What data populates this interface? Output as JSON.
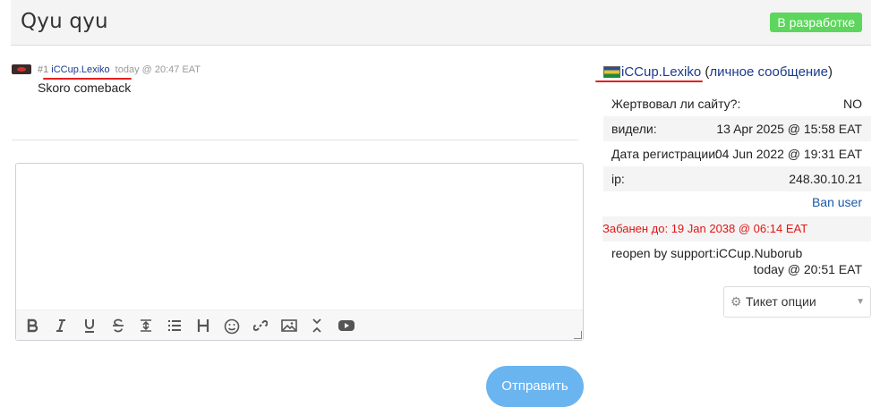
{
  "header": {
    "title": "Qyu qyu",
    "status": "В разработке",
    "status_color": "#5cd65c"
  },
  "message": {
    "number": "#1",
    "author": "iCCup.Lexiko",
    "time": "today @ 20:47 EAT",
    "text": "Skoro comeback"
  },
  "editor": {
    "toolbar": [
      "bold-icon",
      "italic-icon",
      "underline-icon",
      "strikethrough-icon",
      "horizontal-rule-icon",
      "list-icon",
      "heading-icon",
      "smiley-icon",
      "link-icon",
      "image-icon",
      "collapse-icon",
      "youtube-icon"
    ]
  },
  "send_label": "Отправить",
  "sidebar": {
    "user": "iCCup.Lexiko",
    "pm_open": "(",
    "pm_label": "личное сообщение",
    "pm_close": ")",
    "rows": [
      {
        "label": "Жертвовал ли сайту?:",
        "value": "NO"
      },
      {
        "label": "видели:",
        "value": "13 Apr 2025 @ 15:58 EAT"
      },
      {
        "label": "Дата регистрации:",
        "value": "04 Jun 2022 @ 19:31 EAT"
      },
      {
        "label": "ip:",
        "value": "248.30.10.21"
      }
    ],
    "ban_user": "Ban user",
    "banned_until": "Забанен до: 19 Jan 2038 @ 06:14 EAT",
    "reopen": "reopen by support:iCCup.Nuborub",
    "reopen_time": "today @ 20:51 EAT",
    "ticket_options": "Тикет опции"
  },
  "colors": {
    "link": "#1a3a8c",
    "banned": "#e01616",
    "send_button": "#6ab4f0",
    "annotation_underline": "#e02020"
  }
}
